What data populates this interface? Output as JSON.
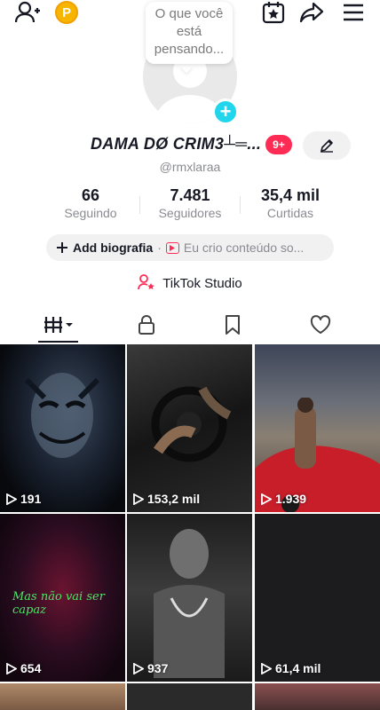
{
  "profile_note": "O que você está pensando...",
  "profile": {
    "name": "DAMA DØ CRIM3┴═...",
    "notification_badge": "9+",
    "username": "@rmxlaraa"
  },
  "stats": [
    {
      "value": "66",
      "label": "Seguindo"
    },
    {
      "value": "7.481",
      "label": "Seguidores"
    },
    {
      "value": "35,4 mil",
      "label": "Curtidas"
    }
  ],
  "bio": {
    "add_label": "Add biografia",
    "separator": "·",
    "studio_snippet": "Eu crio conteúdo so..."
  },
  "studio": {
    "label": "TikTok Studio"
  },
  "tabs": [
    "videos-grid-icon",
    "lock-icon",
    "bookmark-icon",
    "heart-icon"
  ],
  "videos": [
    {
      "views": "191"
    },
    {
      "views": "153,2 mil"
    },
    {
      "views": "1.939"
    },
    {
      "views": "654",
      "overlay": "Mas não vai ser capaz"
    },
    {
      "views": "937"
    },
    {
      "views": "61,4 mil"
    }
  ],
  "colors": {
    "accent_red": "#fe2c55",
    "accent_cyan": "#20d5ec",
    "coin": "#f7b500",
    "text_primary": "#161823",
    "text_secondary": "#8a8b91"
  }
}
